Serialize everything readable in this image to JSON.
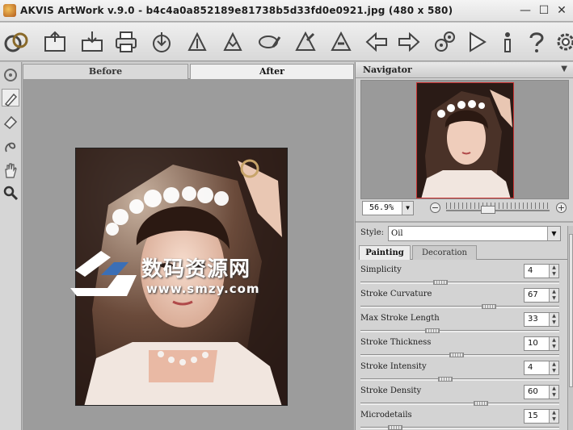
{
  "window": {
    "title": "AKVIS ArtWork v.9.0 - b4c4a0a852189e81738b5d33fd0e0921.jpg (480 x 580)",
    "controls": [
      "minimize",
      "maximize",
      "close"
    ]
  },
  "toolbar": {
    "buttons": [
      {
        "icon": "artwork-logo-icon"
      },
      {
        "icon": "open-file-icon"
      },
      {
        "icon": "save-icon"
      },
      {
        "icon": "print-icon"
      },
      {
        "icon": "import-strokes-icon"
      },
      {
        "icon": "export-strokes-icon"
      },
      {
        "icon": "batch-icon"
      },
      {
        "icon": "share-icon"
      },
      {
        "icon": "load-preset-icon"
      },
      {
        "icon": "save-preset-icon"
      },
      {
        "icon": "undo-arrow-icon"
      },
      {
        "icon": "redo-arrow-icon"
      },
      {
        "icon": "preferences-icon"
      },
      {
        "icon": "run-icon"
      },
      {
        "icon": "info-icon"
      },
      {
        "icon": "help-icon"
      },
      {
        "icon": "settings-gear-icon"
      }
    ]
  },
  "left_tools": [
    {
      "icon": "preview-window-icon"
    },
    {
      "icon": "brush-icon"
    },
    {
      "icon": "eraser-icon"
    },
    {
      "icon": "smudge-icon"
    },
    {
      "icon": "hand-icon"
    },
    {
      "icon": "zoom-icon"
    }
  ],
  "view_tabs": {
    "before": "Before",
    "after": "After",
    "active": "after"
  },
  "watermark": {
    "chinese": "数码资源网",
    "url": "www.smzy.com"
  },
  "navigator": {
    "label": "Navigator",
    "zoom_value": "56.9%",
    "zoom_out": "−",
    "zoom_in": "+"
  },
  "style": {
    "label": "Style:",
    "value": "Oil"
  },
  "param_tabs": {
    "painting": "Painting",
    "decoration": "Decoration",
    "active": "painting"
  },
  "parameters": [
    {
      "label": "Simplicity",
      "value": "4"
    },
    {
      "label": "Stroke Curvature",
      "value": "67"
    },
    {
      "label": "Max Stroke Length",
      "value": "33"
    },
    {
      "label": "Stroke Thickness",
      "value": "10"
    },
    {
      "label": "Stroke Intensity",
      "value": "4"
    },
    {
      "label": "Stroke Density",
      "value": "60"
    },
    {
      "label": "Microdetails",
      "value": "15"
    }
  ],
  "colors": {
    "accent": "#3b6fb6",
    "canvas_bg": "#9c9c9c",
    "panel_bg": "#d3d3d3"
  }
}
